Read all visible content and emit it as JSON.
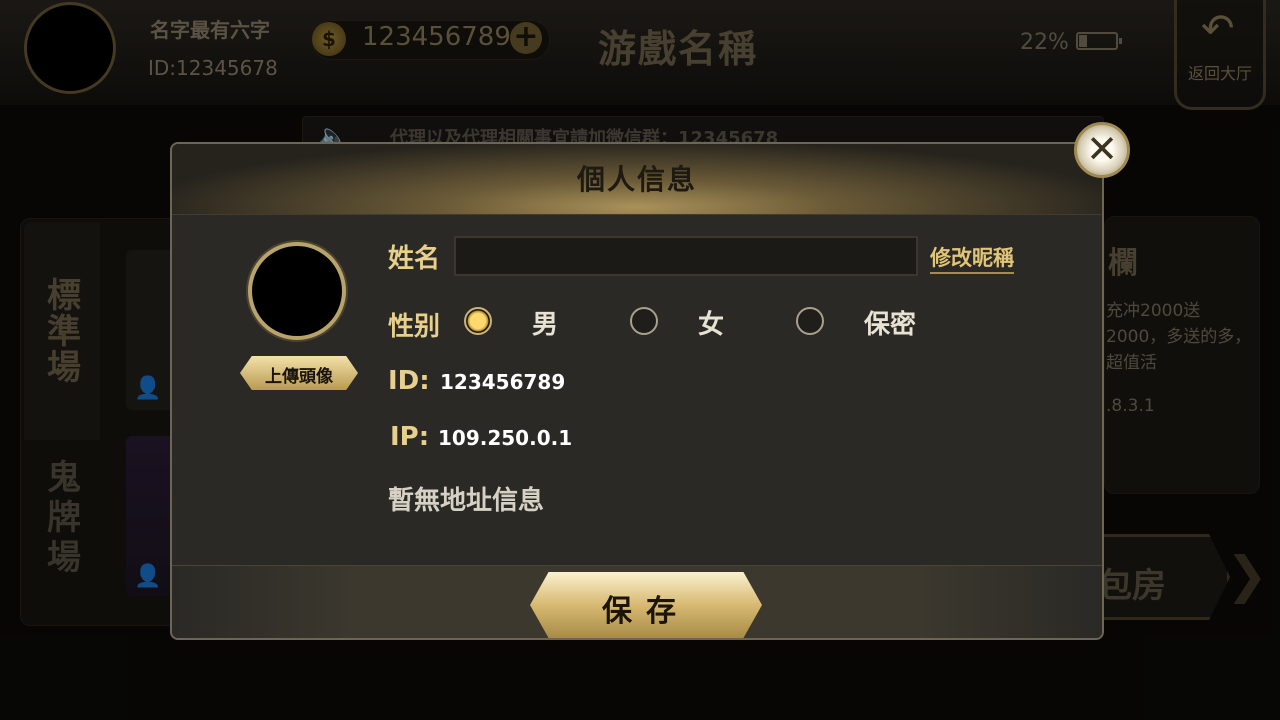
{
  "header": {
    "username": "名字最有六字",
    "user_id": "ID:12345678",
    "coins": "123456789",
    "coin_icon": "$",
    "add_icon": "+",
    "game_name": "游戲名稱",
    "battery_pct": "22%",
    "back_icon": "↶",
    "back_label": "返回大厅"
  },
  "notice": {
    "icon": "speaker-icon",
    "text": "代理以及代理相關事宜請加微信群：12345678"
  },
  "left_panel": {
    "tabs": [
      "標準場",
      "鬼牌場"
    ],
    "user_icon": "👤"
  },
  "right_panel": {
    "title": "欄",
    "promo": "充冲2000送2000，多送的多，超值活",
    "version": ".8.3.1",
    "room_button": "包房",
    "chevron": "❯"
  },
  "modal": {
    "title": "個人信息",
    "close_icon": "✕",
    "upload_avatar": "上傳頭像",
    "name_label": "姓名",
    "name_value": "",
    "edit_nickname": "修改昵稱",
    "gender_label": "性别",
    "gender_options": [
      "男",
      "女",
      "保密"
    ],
    "gender_selected": "男",
    "id_label": "ID:",
    "id_value": "123456789",
    "ip_label": "IP:",
    "ip_value": "109.250.0.1",
    "no_address": "暫無地址信息",
    "save": "保存"
  },
  "colors": {
    "gold": "#e7cf8c",
    "modal_bg": "#2a2925",
    "accent": "#d7b971"
  }
}
